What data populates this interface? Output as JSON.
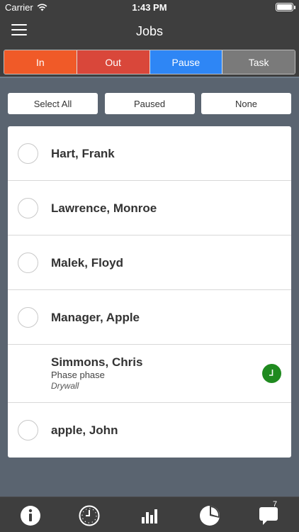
{
  "status_bar": {
    "carrier": "Carrier",
    "time": "1:43 PM"
  },
  "nav": {
    "title": "Jobs",
    "menu_icon": "hamburger-menu-icon"
  },
  "segments": [
    {
      "label": "In",
      "color": "#f05a28"
    },
    {
      "label": "Out",
      "color": "#d9473a"
    },
    {
      "label": "Pause",
      "color": "#2e86f5"
    },
    {
      "label": "Task",
      "color": "#7a7a7a"
    }
  ],
  "filters": {
    "select_all": "Select All",
    "paused": "Paused",
    "none": "None"
  },
  "employees": [
    {
      "name": "Hart, Frank"
    },
    {
      "name": "Lawrence, Monroe"
    },
    {
      "name": "Malek, Floyd"
    },
    {
      "name": "Manager, Apple"
    },
    {
      "name": "Simmons, Chris",
      "phase": "Phase phase",
      "job": "Drywall",
      "status_icon": "clock-icon"
    },
    {
      "name": "apple, John"
    }
  ],
  "tab_bar": {
    "items": [
      "info-icon",
      "clock-icon",
      "bar-chart-icon",
      "pie-chart-icon",
      "chat-bubble-icon"
    ],
    "message_count": "7"
  }
}
